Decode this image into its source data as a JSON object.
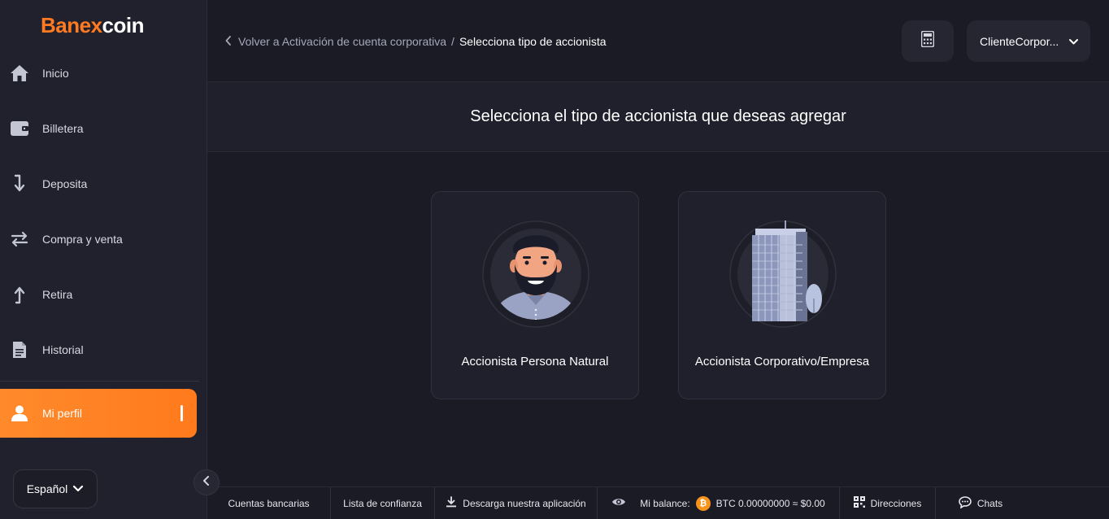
{
  "app": {
    "logo_prefix": "B",
    "logo_rest": "anex",
    "logo_suffix": "coin"
  },
  "sidebar": {
    "items": [
      {
        "label": "Inicio",
        "icon": "home-icon"
      },
      {
        "label": "Billetera",
        "icon": "wallet-icon"
      },
      {
        "label": "Deposita",
        "icon": "arrow-down-icon"
      },
      {
        "label": "Compra y venta",
        "icon": "swap-icon"
      },
      {
        "label": "Retira",
        "icon": "arrow-up-icon"
      },
      {
        "label": "Historial",
        "icon": "document-icon"
      }
    ],
    "active_item": {
      "label": "Mi perfil",
      "icon": "user-icon"
    },
    "language": "Español"
  },
  "header": {
    "back_label": "Volver a Activación de cuenta corporativa",
    "separator": "/",
    "current_label": "Selecciona tipo de accionista",
    "user_name": "ClienteCorpor..."
  },
  "main": {
    "title": "Selecciona el tipo de accionista que deseas agregar",
    "cards": [
      {
        "label": "Accionista Persona Natural",
        "icon": "person-avatar-icon"
      },
      {
        "label": "Accionista Corporativo/Empresa",
        "icon": "building-icon"
      }
    ]
  },
  "footer": {
    "bank_accounts": "Cuentas bancarias",
    "trust_list": "Lista de confianza",
    "download_app": "Descarga nuestra aplicación",
    "balance_label": "Mi balance:",
    "balance_value": "BTC 0.00000000 ≈ $0.00",
    "addresses": "Direcciones",
    "chats": "Chats"
  },
  "colors": {
    "accent": "#ff7a21",
    "background": "#1b1b26",
    "sidebar": "#20212c",
    "card": "#1f202b"
  }
}
